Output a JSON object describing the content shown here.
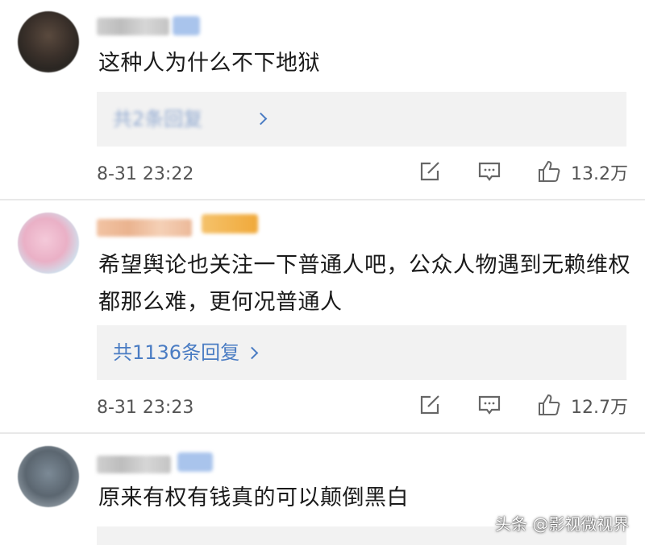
{
  "comments": [
    {
      "text": "这种人为什么不下地狱",
      "reply_label": "共2条回复",
      "timestamp": "8-31 23:22",
      "like_count": "13.2万"
    },
    {
      "text": "希望舆论也关注一下普通人吧，公众人物遇到无赖维权都那么难，更何况普通人",
      "reply_label": "共1136条回复",
      "timestamp": "8-31 23:23",
      "like_count": "12.7万"
    },
    {
      "text": "原来有权有钱真的可以颠倒黑白"
    }
  ],
  "icons": {
    "share": "share-icon",
    "comment": "comment-icon",
    "like": "thumbs-up-icon"
  },
  "colors": {
    "link": "#4a7cc3",
    "text": "#1a1a1a",
    "meta": "#555555",
    "reply_bg": "#f2f2f2"
  },
  "watermark": "头条 @影视微视界"
}
